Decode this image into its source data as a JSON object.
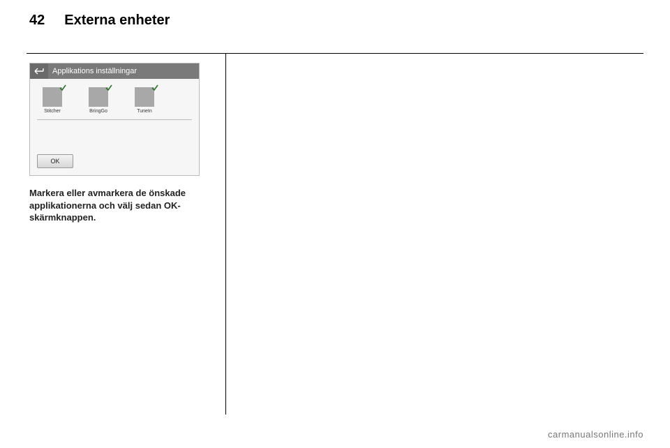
{
  "header": {
    "page_number": "42",
    "section_title": "Externa enheter"
  },
  "screen": {
    "title": "Applikations inställningar",
    "apps": [
      {
        "label": "Stitcher"
      },
      {
        "label": "BringGo"
      },
      {
        "label": "TuneIn"
      }
    ],
    "ok_label": "OK"
  },
  "body_text": "Markera eller avmarkera de önskade applikationerna och välj sedan OK-skärmknappen.",
  "watermark": "carmanualsonline.info"
}
